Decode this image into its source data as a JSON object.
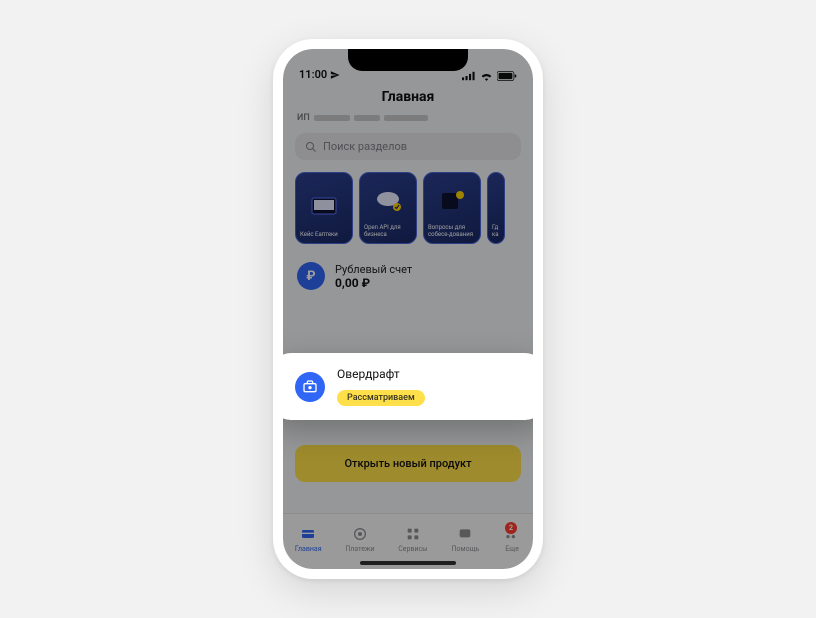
{
  "status": {
    "time": "11:00"
  },
  "header": {
    "title": "Главная",
    "prefix": "ИП"
  },
  "search": {
    "placeholder": "Поиск разделов"
  },
  "stories": [
    {
      "label": "Кейс Еаптеки"
    },
    {
      "label": "Open API для бизнеса"
    },
    {
      "label": "Вопросы для собесе-дования"
    },
    {
      "label": "Гд ка"
    }
  ],
  "account": {
    "name": "Рублевый счет",
    "balance": "0,00 ₽",
    "currency_symbol": "₽"
  },
  "overdraft": {
    "title": "Овердрафт",
    "status": "Рассматриваем"
  },
  "cta": {
    "label": "Открыть новый продукт"
  },
  "tabs": [
    {
      "label": "Главная",
      "active": true
    },
    {
      "label": "Платежи"
    },
    {
      "label": "Сервисы"
    },
    {
      "label": "Помощь"
    },
    {
      "label": "Еще",
      "badge": "2"
    }
  ]
}
